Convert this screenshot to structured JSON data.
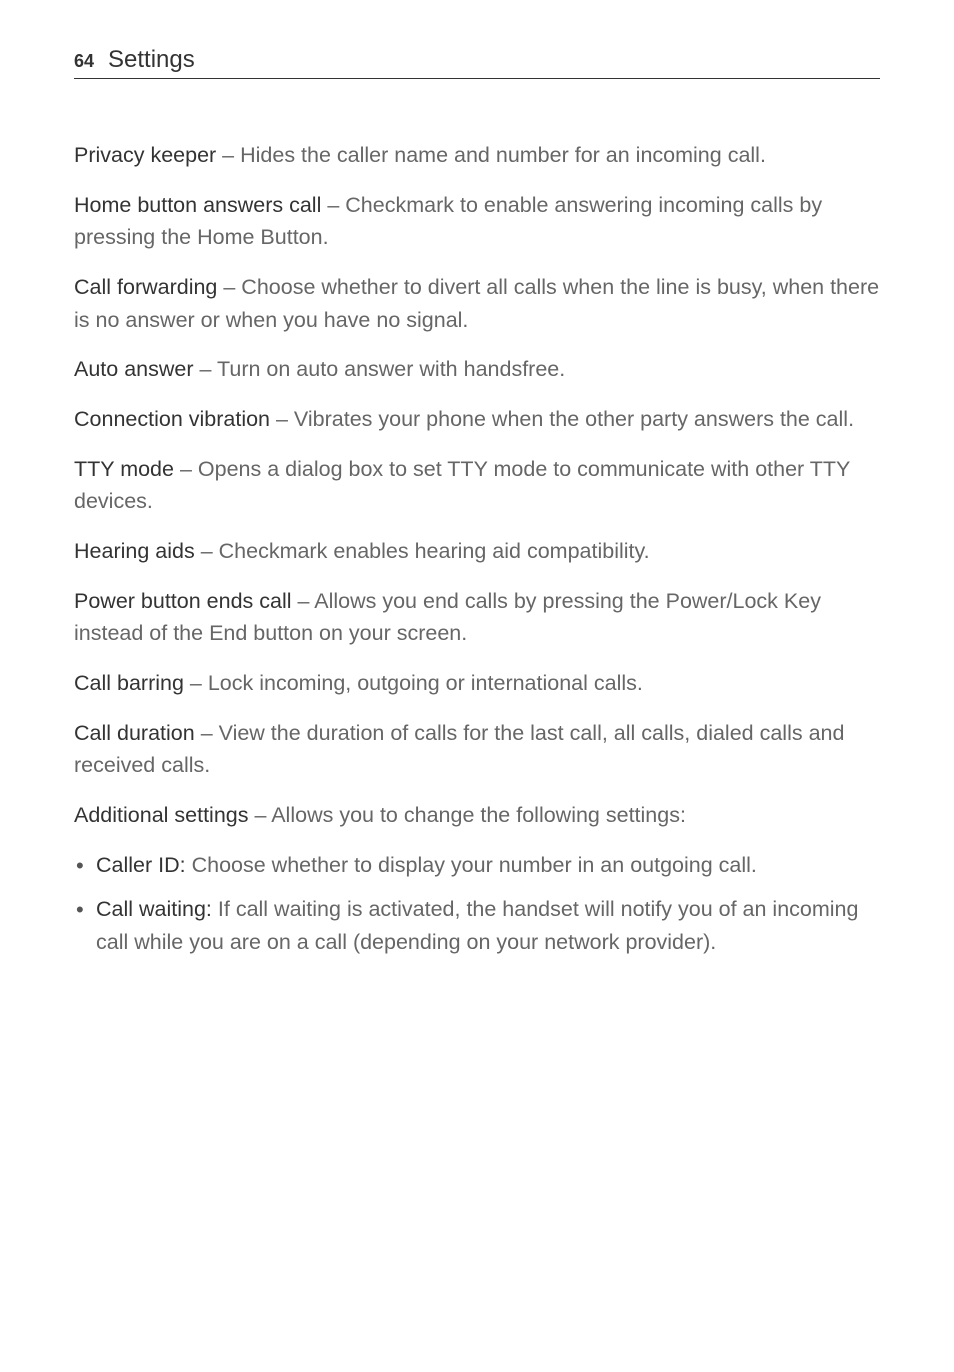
{
  "header": {
    "page_number": "64",
    "section_title": "Settings"
  },
  "items": [
    {
      "term": "Privacy keeper",
      "desc": " – Hides the caller name and number for an incoming call."
    },
    {
      "term": "Home button answers call",
      "desc": " – Checkmark to enable answering incoming calls by pressing the Home Button."
    },
    {
      "term": "Call forwarding",
      "desc": " – Choose whether to divert all calls when the line is busy, when there is no answer or when you have no signal."
    },
    {
      "term": "Auto answer",
      "desc": " – Turn on auto answer with handsfree."
    },
    {
      "term": "Connection vibration",
      "desc": " – Vibrates your phone when the other party answers the call."
    },
    {
      "term": "TTY mode",
      "desc": " – Opens a dialog box to set TTY mode to communicate with other TTY devices."
    },
    {
      "term": "Hearing aids",
      "desc": " – Checkmark enables hearing aid compatibility."
    },
    {
      "term": "Power button ends call",
      "desc": " – Allows you end calls by pressing the Power/Lock Key instead of the End button on your screen."
    },
    {
      "term": "Call barring",
      "desc": " – Lock incoming, outgoing or international calls."
    },
    {
      "term": "Call duration",
      "desc": " – View the duration of calls for the last call, all calls, dialed calls and received calls."
    },
    {
      "term": "Additional settings",
      "desc": " – Allows you to change the following settings:"
    }
  ],
  "bullets": [
    {
      "term": "Caller ID:",
      "desc": " Choose whether to display your number in an outgoing call."
    },
    {
      "term": "Call waiting:",
      "desc": " If call waiting is activated, the handset will notify you of an incoming call while you are on a call (depending on your network provider)."
    }
  ]
}
